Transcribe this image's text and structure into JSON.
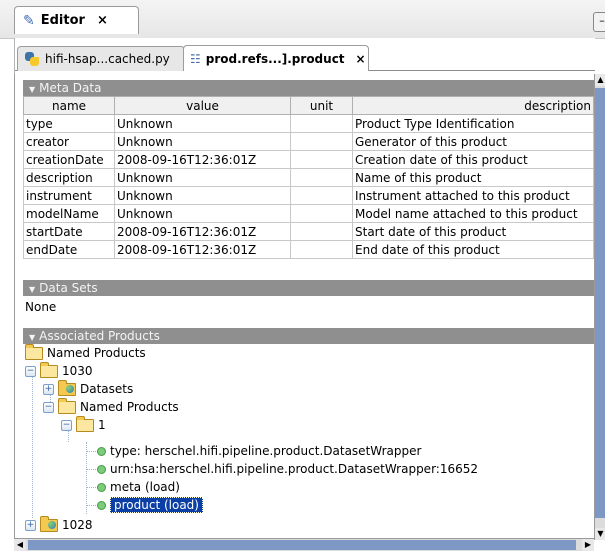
{
  "editor_tab": {
    "label": "Editor",
    "close": "×",
    "minimize": "–"
  },
  "file_tabs": [
    {
      "label": "hifi-hsap...cached.py"
    },
    {
      "label": "prod.refs...].product",
      "close": "×"
    }
  ],
  "meta_section": {
    "title": "Meta Data",
    "columns": [
      "name",
      "value",
      "unit",
      "description"
    ],
    "rows": [
      {
        "name": "type",
        "value": "Unknown",
        "unit": "",
        "description": "Product Type Identification"
      },
      {
        "name": "creator",
        "value": "Unknown",
        "unit": "",
        "description": "Generator of this product"
      },
      {
        "name": "creationDate",
        "value": "2008-09-16T12:36:01Z",
        "unit": "",
        "description": "Creation date of this product"
      },
      {
        "name": "description",
        "value": "Unknown",
        "unit": "",
        "description": "Name of this product"
      },
      {
        "name": "instrument",
        "value": "Unknown",
        "unit": "",
        "description": "Instrument attached to this product"
      },
      {
        "name": "modelName",
        "value": "Unknown",
        "unit": "",
        "description": "Model name attached to this product"
      },
      {
        "name": "startDate",
        "value": "2008-09-16T12:36:01Z",
        "unit": "",
        "description": "Start date of this product"
      },
      {
        "name": "endDate",
        "value": "2008-09-16T12:36:01Z",
        "unit": "",
        "description": "End date of this product"
      }
    ]
  },
  "datasets_section": {
    "title": "Data Sets",
    "content": "None"
  },
  "assoc_section": {
    "title": "Associated Products",
    "tree": {
      "root": "Named Products",
      "n1030": "1030",
      "datasets": "Datasets",
      "named_products": "Named Products",
      "n1": "1",
      "leaf_type": "type: herschel.hifi.pipeline.product.DatasetWrapper",
      "leaf_urn": "urn:hsa:herschel.hifi.pipeline.product.DatasetWrapper:16652",
      "leaf_meta": "meta (load)",
      "leaf_product": "product (load)",
      "n1028": "1028"
    }
  },
  "colors": {
    "section_header": "#8f8f8f",
    "selection": "#0b3fa5",
    "scroll_thumb": "#7e98c6"
  }
}
